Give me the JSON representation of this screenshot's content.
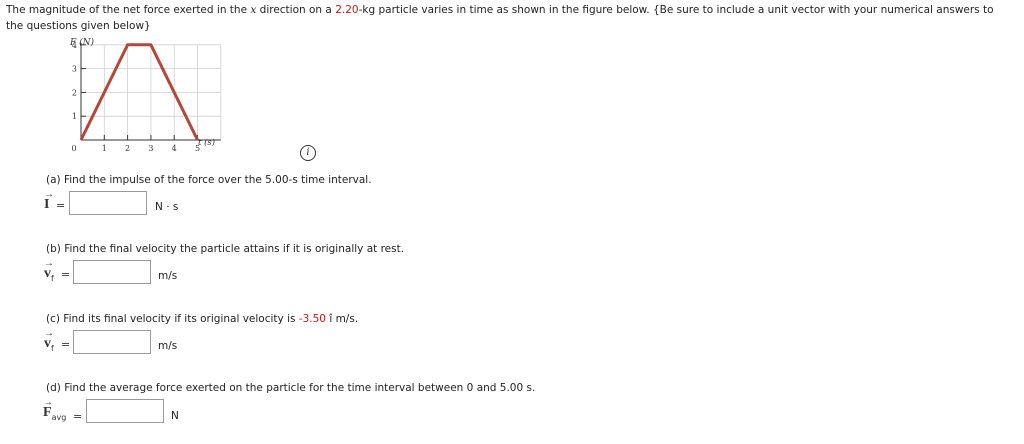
{
  "intro": {
    "before_x": "The magnitude of the net force exerted in the ",
    "x": "x",
    "after_x": " direction on a ",
    "mass": "2.20",
    "after_mass": "-kg particle varies in time as shown in the figure below. {Be sure to include a unit vector with your numerical answers to the questions given below}"
  },
  "chart_data": {
    "type": "line",
    "ylabel": "F (N)",
    "xlabel": "t (s)",
    "x_ticks": [
      "0",
      "1",
      "2",
      "3",
      "4",
      "5"
    ],
    "y_ticks": [
      "1",
      "2",
      "3",
      "4"
    ],
    "xlim": [
      0,
      5
    ],
    "ylim": [
      0,
      4
    ],
    "grid": true,
    "series": [
      {
        "x": [
          0,
          2,
          3,
          5
        ],
        "y": [
          0,
          4,
          4,
          0
        ],
        "color": "#b2483a"
      }
    ]
  },
  "info_icon": "i",
  "parts": {
    "a": {
      "question": "(a) Find the impulse of the force over the 5.00-s time interval.",
      "symbol": "I",
      "equals": "=",
      "value": "",
      "unit": "N · s"
    },
    "b": {
      "question": "(b) Find the final velocity the particle attains if it is originally at rest.",
      "symbol": "v",
      "sub": "f",
      "equals": "=",
      "value": "",
      "unit": "m/s"
    },
    "c": {
      "question_before": "(c) Find its final velocity if its original velocity is ",
      "velocity": "-3.50",
      "question_after": " î m/s.",
      "symbol": "v",
      "sub": "f",
      "equals": "=",
      "value": "",
      "unit": "m/s"
    },
    "d": {
      "question": "(d) Find the average force exerted on the particle for the time interval between 0 and 5.00 s.",
      "symbol": "F",
      "sub": "avg",
      "equals": "=",
      "value": "",
      "unit": "N"
    }
  }
}
